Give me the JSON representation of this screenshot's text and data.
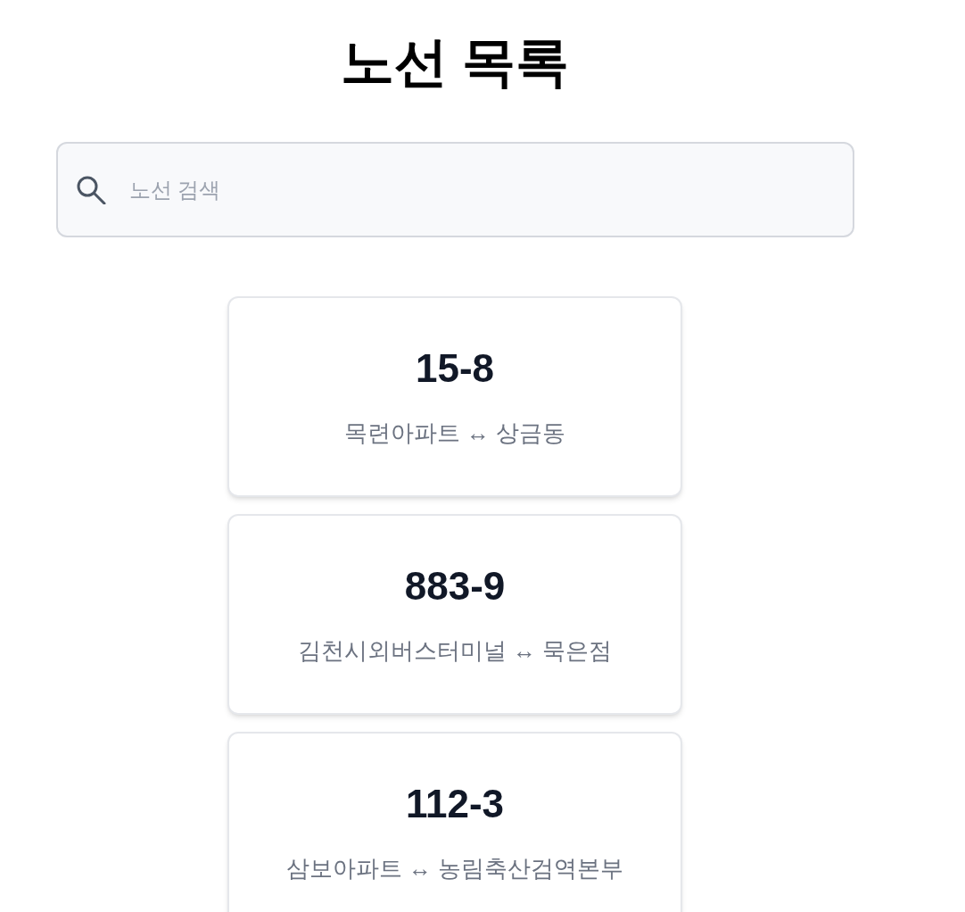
{
  "title": "노선 목록",
  "search": {
    "placeholder": "노선 검색"
  },
  "routes": [
    {
      "number": "15-8",
      "endpoints": "목련아파트 ↔ 상금동"
    },
    {
      "number": "883-9",
      "endpoints": "김천시외버스터미널 ↔ 묵은점"
    },
    {
      "number": "112-3",
      "endpoints": "삼보아파트 ↔ 농림축산검역본부"
    }
  ]
}
